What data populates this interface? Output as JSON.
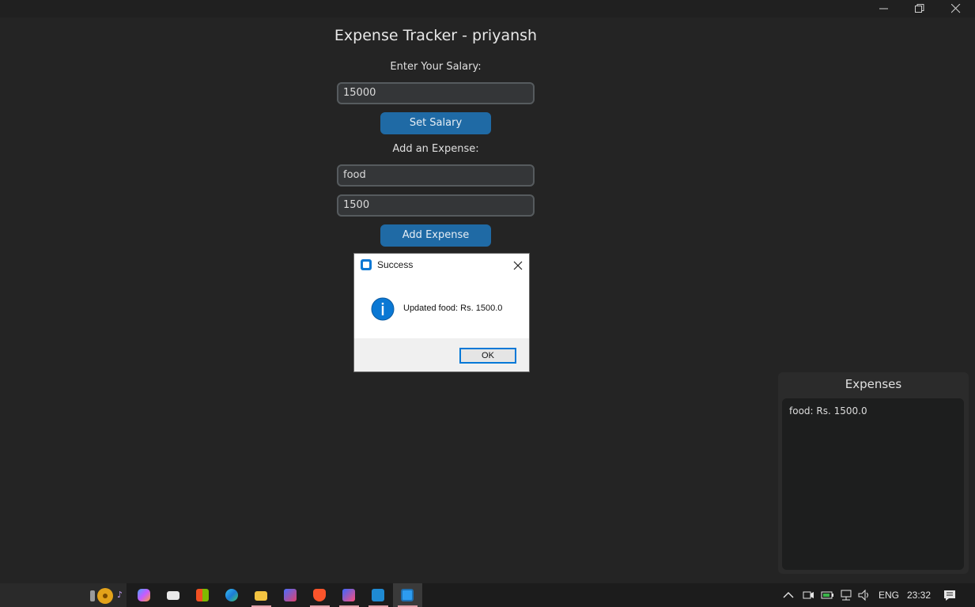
{
  "app": {
    "title": "Expense Tracker - priyansh",
    "salary_label": "Enter Your Salary:",
    "salary_value": "15000",
    "set_salary_button": "Set Salary",
    "expense_label": "Add an Expense:",
    "expense_name_value": "food",
    "expense_amount_value": "1500",
    "add_expense_button": "Add Expense"
  },
  "dialog": {
    "title": "Success",
    "message": "Updated food: Rs. 1500.0",
    "ok_label": "OK"
  },
  "expenses_panel": {
    "title": "Expenses",
    "items": [
      "food: Rs. 1500.0"
    ]
  },
  "taskbar": {
    "language": "ENG",
    "time": "23:32"
  },
  "colors": {
    "background": "#242424",
    "button": "#1f6aa5",
    "entry_bg": "#343638",
    "info_icon": "#0a78d4"
  }
}
